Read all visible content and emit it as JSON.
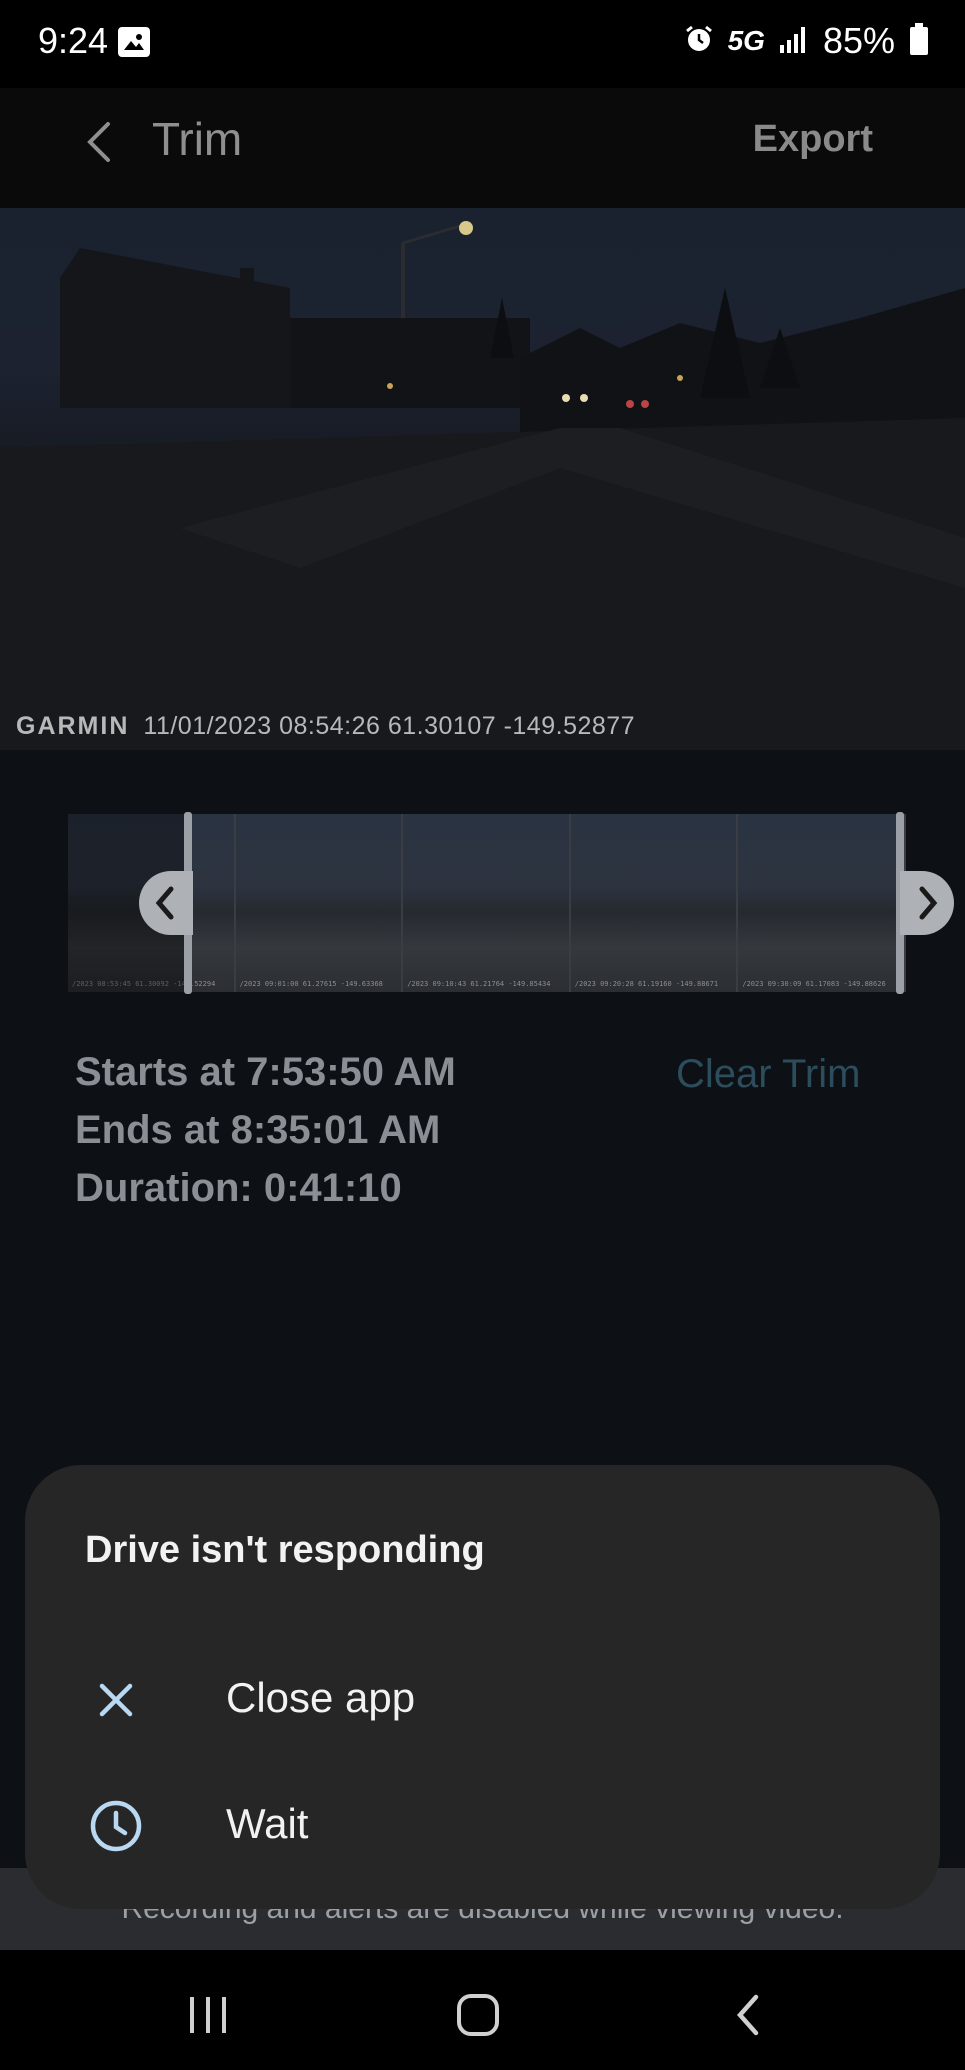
{
  "status_bar": {
    "time": "9:24",
    "network": "5G",
    "battery": "85%",
    "icons": [
      "gallery-icon",
      "alarm-icon",
      "signal-icon",
      "battery-icon"
    ]
  },
  "app_bar": {
    "title": "Trim",
    "export_label": "Export"
  },
  "video": {
    "brand": "GARMIN",
    "overlay": "11/01/2023 08:54:26  61.30107 -149.52877"
  },
  "filmstrip": {
    "frames": [
      "/2023 08:53:45 61.30092 -149.52294",
      "/2023 09:01:00 61.27615 -149.63368",
      "/2023 09:10:43 61.21764 -149.85434",
      "/2023 09:20:28 61.19160 -149.88671",
      "/2023 09:30:09 61.17083 -149.88626"
    ]
  },
  "trim_info": {
    "starts": "Starts at 7:53:50 AM",
    "ends": "Ends at 8:35:01 AM",
    "duration": "Duration: 0:41:10",
    "clear_label": "Clear Trim"
  },
  "hint": "Recording and alerts are disabled while viewing video.",
  "dialog": {
    "title": "Drive isn't responding",
    "options": [
      {
        "label": "Close app",
        "icon": "close-icon"
      },
      {
        "label": "Wait",
        "icon": "clock-icon"
      }
    ]
  },
  "colors": {
    "accent": "#2b4d5c",
    "dialog_bg": "#262626",
    "icon_blue": "#b9d8f2"
  }
}
